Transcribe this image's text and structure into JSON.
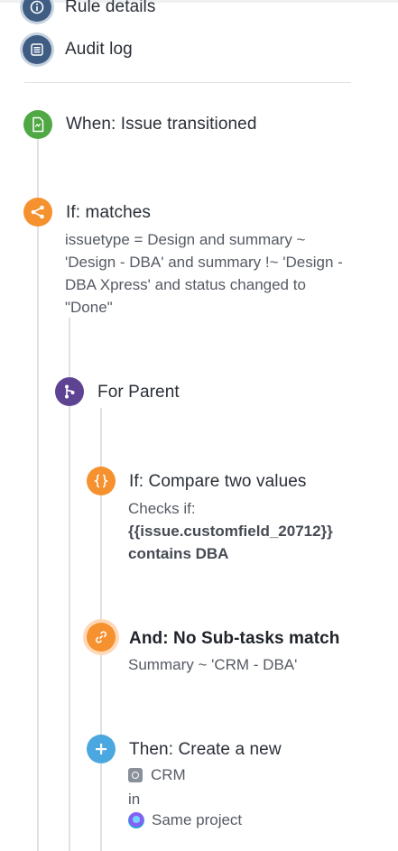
{
  "nav": {
    "rule_details_label": "Rule details",
    "audit_log_label": "Audit log"
  },
  "trigger": {
    "title": "When: Issue transitioned",
    "icon": "trigger-icon"
  },
  "condition_jql": {
    "title": "If: matches",
    "lines": [
      "issuetype = Design and summary ~",
      "'Design - DBA' and summary !~ 'Design -",
      "DBA Xpress' and status changed to",
      "\"Done\""
    ],
    "icon": "branch-share-icon"
  },
  "branch": {
    "title": "For Parent",
    "icon": "branch-icon"
  },
  "compare": {
    "title": "If: Compare two values",
    "checks_label": "Checks if:",
    "lines": [
      "{{issue.customfield_20712}}",
      "contains DBA"
    ],
    "icon": "curly-braces-icon"
  },
  "subtasks": {
    "title": "And: No Sub-tasks match",
    "detail": "Summary ~ 'CRM - DBA'",
    "icon": "link-icon"
  },
  "action": {
    "title": "Then: Create a new",
    "issue_type": "CRM",
    "in_label": "in",
    "project": "Same project",
    "icon": "plus-icon"
  },
  "colors": {
    "trigger": "#4fa843",
    "condition": "#f5912e",
    "branch": "#5e4393",
    "action": "#4ba7e0",
    "nav": "#3f5d82"
  }
}
